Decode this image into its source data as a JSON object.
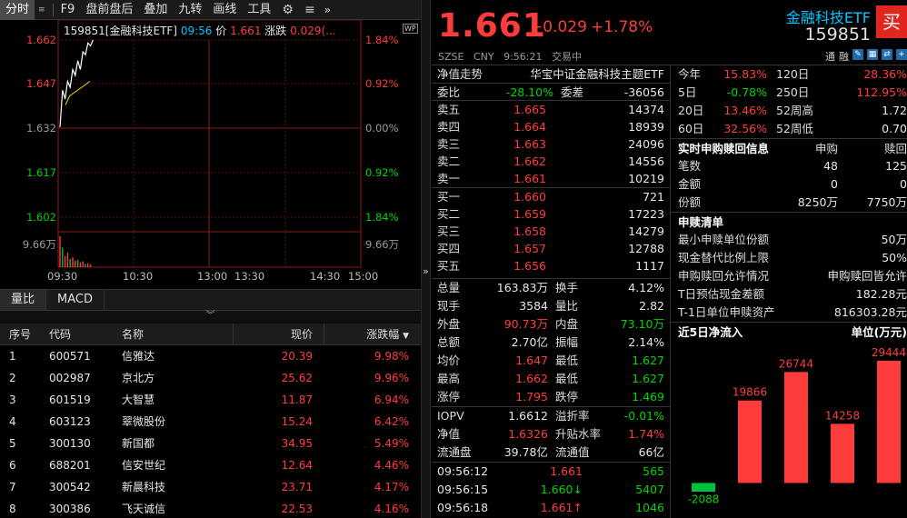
{
  "toolbar": {
    "tabs": [
      "分时",
      "F9",
      "盘前盘后",
      "叠加",
      "九转",
      "画线",
      "工具"
    ],
    "active": "分时"
  },
  "chart": {
    "header_code": "159851[金融科技ETF]",
    "header_time": "09:56",
    "header_price_label": "价",
    "header_price": "1.661",
    "header_chg_label": "涨跌",
    "header_chg": "0.029(...",
    "wp_badge": "WP",
    "y_left": [
      "1.662",
      "1.647",
      "1.632",
      "1.617",
      "1.602"
    ],
    "y_right": [
      "1.84%",
      "0.92%",
      "0.00%",
      "0.92%",
      "1.84%"
    ],
    "vol_label": "9.66万",
    "x_labels": [
      "09:30",
      "10:30",
      "13:00",
      "13:30",
      "14:30",
      "15:00"
    ],
    "price_path": [
      1.6325,
      1.645,
      1.642,
      1.648,
      1.646,
      1.652,
      1.65,
      1.655,
      1.652,
      1.658,
      1.657,
      1.661,
      1.66,
      1.662
    ],
    "avg_path": [
      1.64,
      1.643,
      1.644,
      1.645,
      1.646,
      1.647,
      1.648
    ],
    "vol_path": [
      0.95,
      0.6,
      0.35,
      0.45,
      0.25,
      0.3,
      0.2,
      0.22,
      0.15,
      0.18,
      0.1,
      0.12,
      0.08
    ]
  },
  "subtabs": [
    "量比",
    "MACD"
  ],
  "table": {
    "headers": [
      "序号",
      "代码",
      "名称",
      "现价",
      "涨跌幅"
    ],
    "rows": [
      [
        "1",
        "600571",
        "信雅达",
        "20.39",
        "9.98%"
      ],
      [
        "2",
        "002987",
        "京北方",
        "25.62",
        "9.96%"
      ],
      [
        "3",
        "601519",
        "大智慧",
        "11.87",
        "6.94%"
      ],
      [
        "4",
        "603123",
        "翠微股份",
        "15.24",
        "6.42%"
      ],
      [
        "5",
        "300130",
        "新国都",
        "34.95",
        "5.49%"
      ],
      [
        "6",
        "688201",
        "信安世纪",
        "12.64",
        "4.46%"
      ],
      [
        "7",
        "300542",
        "新晨科技",
        "23.71",
        "4.17%"
      ],
      [
        "8",
        "300386",
        "飞天诚信",
        "22.53",
        "4.16%"
      ]
    ]
  },
  "quote": {
    "price": "1.661",
    "change": "+0.029",
    "pct": "+1.78%",
    "market": "SZSE",
    "currency": "CNY",
    "time": "9:56:21",
    "status": "交易中",
    "name": "金融科技ETF",
    "code": "159851",
    "buy": "买",
    "icons": [
      "通",
      "融"
    ]
  },
  "orderbook": {
    "nav_label": "净值走势",
    "fund_name": "华宝中证金融科技主题ETF",
    "wb_label": "委比",
    "wb": "-28.10%",
    "wc_label": "委差",
    "wc": "-36056",
    "asks": [
      [
        "卖五",
        "1.665",
        "14374"
      ],
      [
        "卖四",
        "1.664",
        "18939"
      ],
      [
        "卖三",
        "1.663",
        "24096"
      ],
      [
        "卖二",
        "1.662",
        "14556"
      ],
      [
        "卖一",
        "1.661",
        "10219"
      ]
    ],
    "bids": [
      [
        "买一",
        "1.660",
        "721"
      ],
      [
        "买二",
        "1.659",
        "17223"
      ],
      [
        "买三",
        "1.658",
        "14279"
      ],
      [
        "买四",
        "1.657",
        "12788"
      ],
      [
        "买五",
        "1.656",
        "1117"
      ]
    ],
    "stats": [
      [
        "总量",
        "163.83万",
        "换手",
        "4.12%"
      ],
      [
        "现手",
        "3584",
        "量比",
        "2.82"
      ],
      [
        "外盘",
        "90.73万",
        "内盘",
        "73.10万"
      ],
      [
        "总额",
        "2.70亿",
        "振幅",
        "2.14%"
      ],
      [
        "均价",
        "1.647",
        "最低",
        "1.627"
      ],
      [
        "最高",
        "1.662",
        "最低",
        "1.627"
      ],
      [
        "涨停",
        "1.795",
        "跌停",
        "1.469"
      ]
    ],
    "etf": [
      [
        "IOPV",
        "1.6612",
        "溢折率",
        "-0.01%"
      ],
      [
        "净值",
        "1.6326",
        "升贴水率",
        "1.74%"
      ],
      [
        "流通盘",
        "39.78亿",
        "流通值",
        "66亿"
      ]
    ],
    "ticks": [
      [
        "09:56:12",
        "1.661",
        "565"
      ],
      [
        "09:56:15",
        "1.660",
        "5407"
      ],
      [
        "09:56:18",
        "1.661",
        "1046"
      ]
    ]
  },
  "perf": {
    "rows": [
      [
        "今年",
        "15.83%",
        "120日",
        "28.36%"
      ],
      [
        "5日",
        "-0.78%",
        "250日",
        "112.95%"
      ],
      [
        "20日",
        "13.46%",
        "52周高",
        "1.72"
      ],
      [
        "60日",
        "32.56%",
        "52周低",
        "0.70"
      ]
    ],
    "sg_title": "实时申购赎回信息",
    "sg_h1": "申购",
    "sg_h2": "赎回",
    "sg_rows": [
      [
        "笔数",
        "48",
        "125"
      ],
      [
        "金额",
        "0",
        "0"
      ],
      [
        "份额",
        "8250万",
        "7750万"
      ]
    ],
    "list_title": "申赎清单",
    "list_rows": [
      [
        "最小申赎单位份额",
        "50万"
      ],
      [
        "现金替代比例上限",
        "50%"
      ],
      [
        "申购赎回允许情况",
        "申购赎回皆允许"
      ],
      [
        "T日预估现金差额",
        "182.28元"
      ],
      [
        "T-1日单位申赎资产",
        "816303.28元"
      ]
    ],
    "flow_title": "近5日净流入",
    "flow_unit": "单位(万元)",
    "flow": [
      -2088,
      19866,
      26744,
      14258,
      29444
    ],
    "flow_labels": [
      "-2088",
      "19866",
      "26744",
      "14258",
      "29444"
    ]
  }
}
